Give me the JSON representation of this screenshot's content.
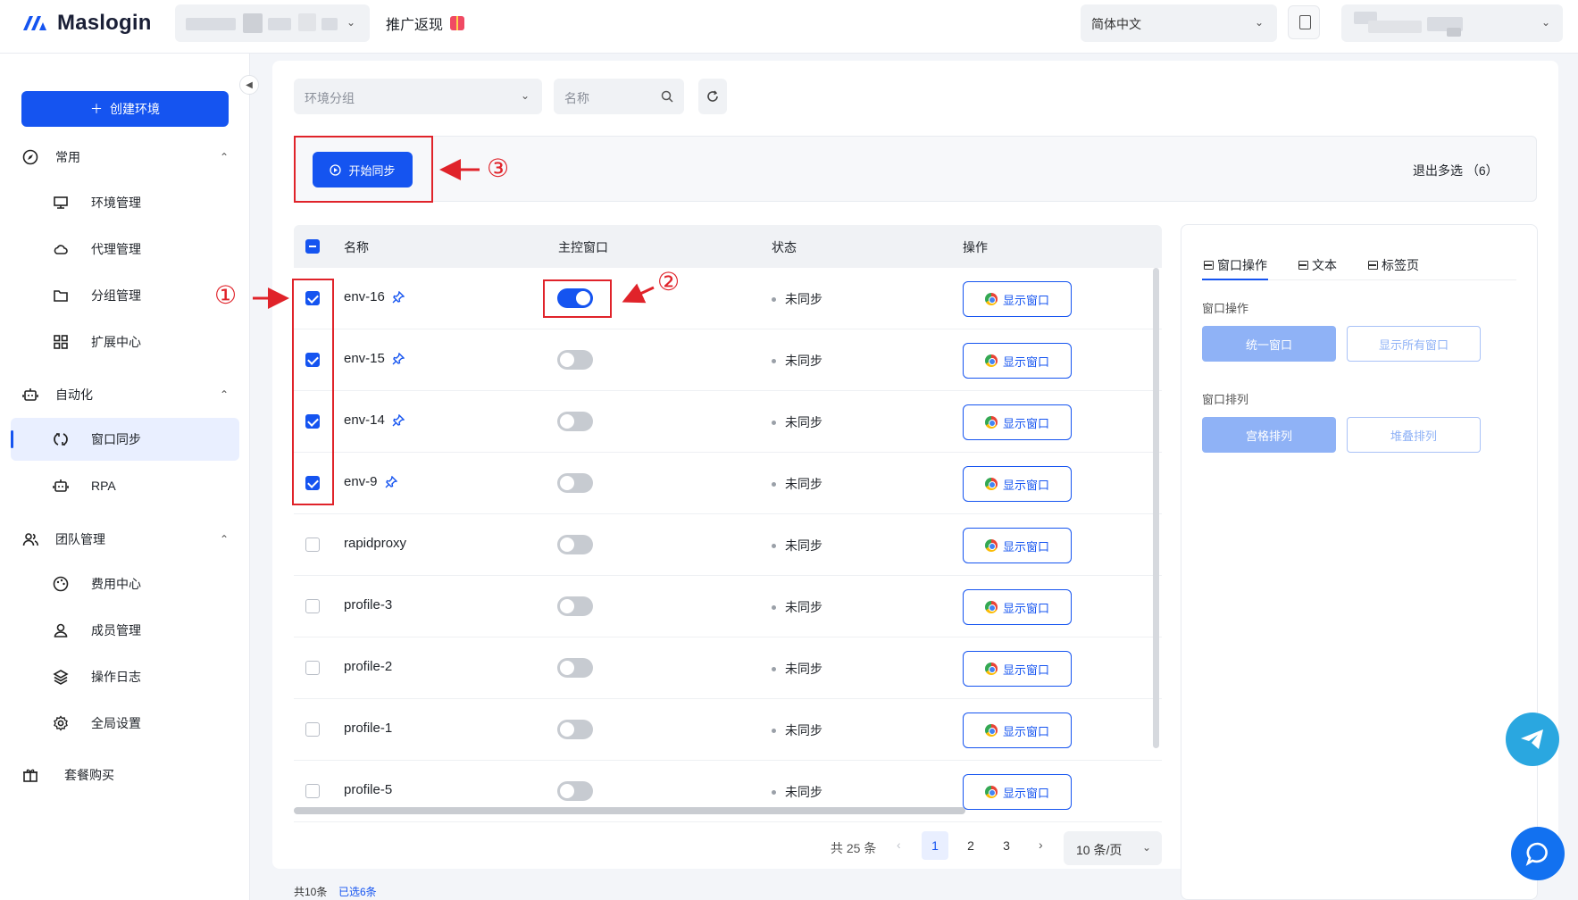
{
  "header": {
    "brand": "Maslogin",
    "promo_label": "推广返现",
    "language": "简体中文"
  },
  "sidebar": {
    "create_label": "创建环境",
    "groups": [
      {
        "label": "常用"
      },
      {
        "label": "自动化"
      },
      {
        "label": "团队管理"
      }
    ],
    "items": [
      {
        "label": "环境管理"
      },
      {
        "label": "代理管理"
      },
      {
        "label": "分组管理"
      },
      {
        "label": "扩展中心"
      },
      {
        "label": "窗口同步"
      },
      {
        "label": "RPA"
      },
      {
        "label": "费用中心"
      },
      {
        "label": "成员管理"
      },
      {
        "label": "操作日志"
      },
      {
        "label": "全局设置"
      }
    ],
    "bottom": "套餐购买"
  },
  "filters": {
    "group_placeholder": "环境分组",
    "name_placeholder": "名称"
  },
  "sync": {
    "start_label": "开始同步",
    "exit_multi": "退出多选 （6）"
  },
  "table": {
    "columns": [
      "名称",
      "主控窗口",
      "状态",
      "操作"
    ],
    "rows": [
      {
        "name": "env-16",
        "checked": true,
        "pinned": true,
        "master": true,
        "status": "未同步",
        "action": "显示窗口"
      },
      {
        "name": "env-15",
        "checked": true,
        "pinned": true,
        "master": false,
        "status": "未同步",
        "action": "显示窗口"
      },
      {
        "name": "env-14",
        "checked": true,
        "pinned": true,
        "master": false,
        "status": "未同步",
        "action": "显示窗口"
      },
      {
        "name": "env-9",
        "checked": true,
        "pinned": true,
        "master": false,
        "status": "未同步",
        "action": "显示窗口"
      },
      {
        "name": "rapidproxy",
        "checked": false,
        "pinned": false,
        "master": false,
        "status": "未同步",
        "action": "显示窗口"
      },
      {
        "name": "profile-3",
        "checked": false,
        "pinned": false,
        "master": false,
        "status": "未同步",
        "action": "显示窗口"
      },
      {
        "name": "profile-2",
        "checked": false,
        "pinned": false,
        "master": false,
        "status": "未同步",
        "action": "显示窗口"
      },
      {
        "name": "profile-1",
        "checked": false,
        "pinned": false,
        "master": false,
        "status": "未同步",
        "action": "显示窗口"
      },
      {
        "name": "profile-5",
        "checked": false,
        "pinned": false,
        "master": false,
        "status": "未同步",
        "action": "显示窗口"
      }
    ]
  },
  "pagination": {
    "total": "共 25 条",
    "pages": [
      "1",
      "2",
      "3"
    ],
    "current": "1",
    "page_size": "10 条/页"
  },
  "footer": {
    "count": "共10条",
    "selected": "已选6条"
  },
  "right_panel": {
    "tabs": [
      "窗口操作",
      "文本",
      "标签页"
    ],
    "section1_label": "窗口操作",
    "unify_label": "统一窗口",
    "show_all_label": "显示所有窗口",
    "section2_label": "窗口排列",
    "grid_label": "宫格排列",
    "stack_label": "堆叠排列"
  },
  "annotations": [
    "①",
    "②",
    "③"
  ],
  "colors": {
    "accent": "#1554f0",
    "annotation": "#e0232a"
  }
}
